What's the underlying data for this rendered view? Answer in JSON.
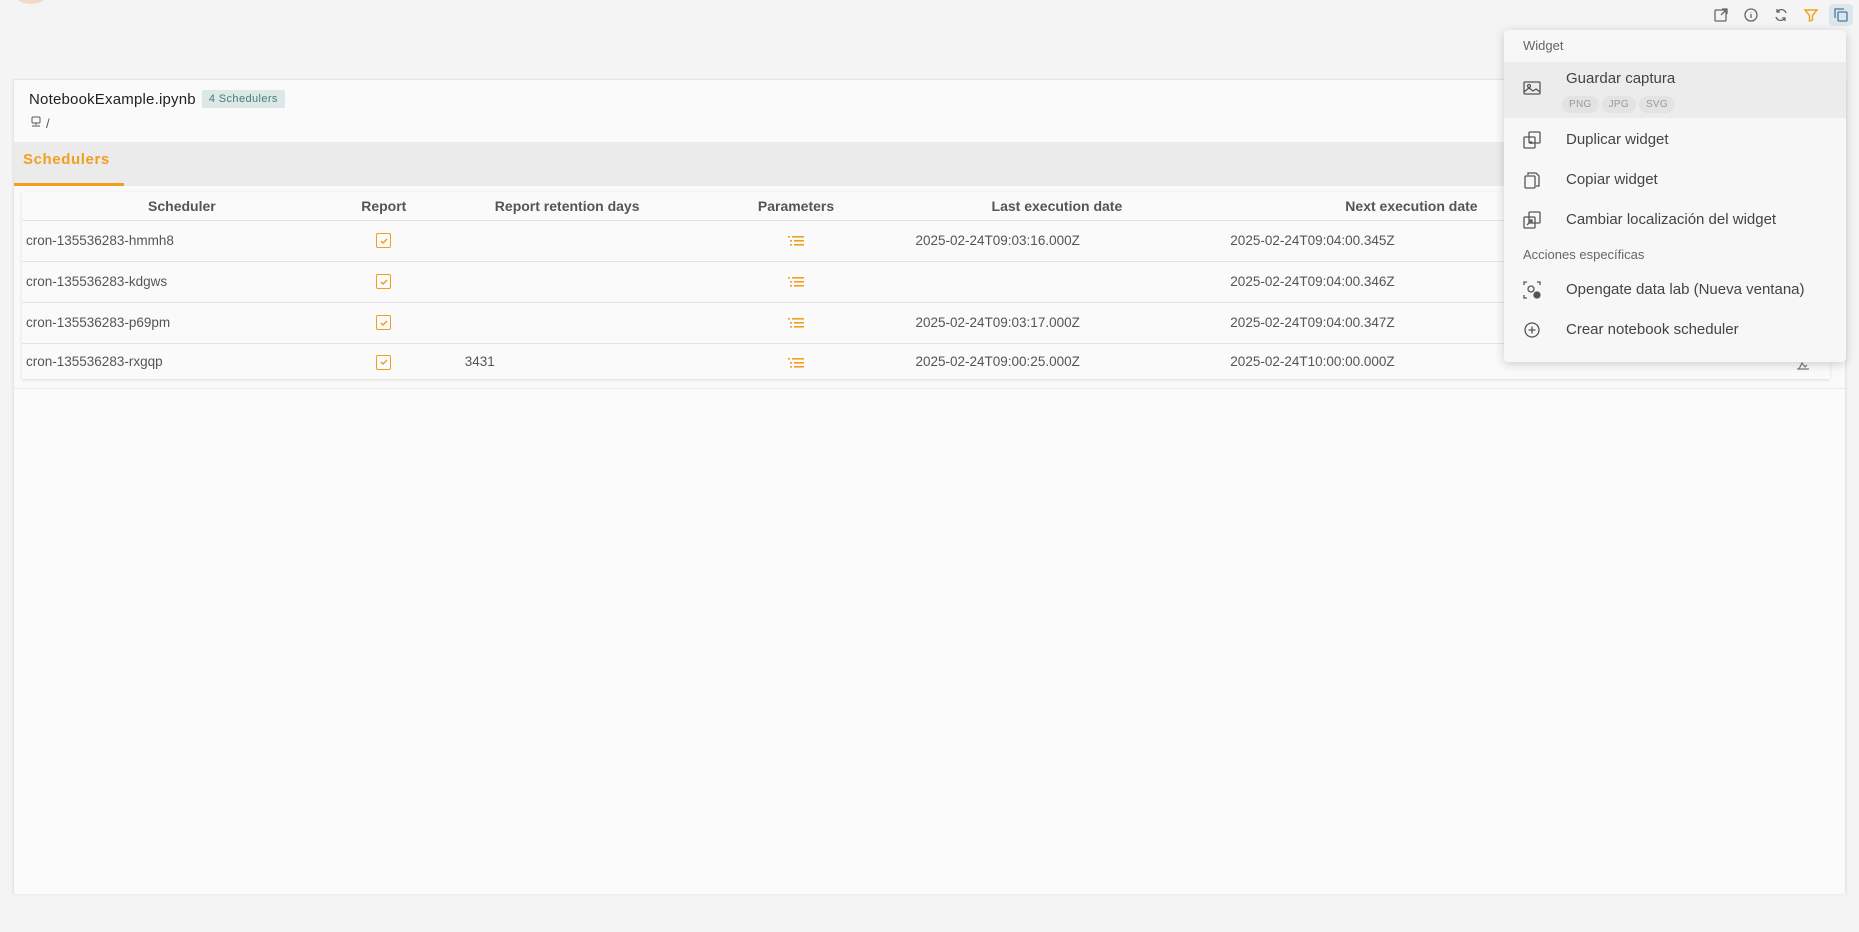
{
  "widget": {
    "title": "NotebookExample.ipynb",
    "badge": "4 Schedulers",
    "path": "/",
    "tab": "Schedulers"
  },
  "table": {
    "headers": [
      "Scheduler",
      "Report",
      "Report retention days",
      "Parameters",
      "Last execution date",
      "Next execution date"
    ],
    "rows": [
      {
        "scheduler": "cron-135536283-hmmh8",
        "report": true,
        "retention": "",
        "last": "2025-02-24T09:03:16.000Z",
        "next": "2025-02-24T09:04:00.345Z"
      },
      {
        "scheduler": "cron-135536283-kdgws",
        "report": true,
        "retention": "",
        "last": "",
        "next": "2025-02-24T09:04:00.346Z"
      },
      {
        "scheduler": "cron-135536283-p69pm",
        "report": true,
        "retention": "",
        "last": "2025-02-24T09:03:17.000Z",
        "next": "2025-02-24T09:04:00.347Z"
      },
      {
        "scheduler": "cron-135536283-rxgqp",
        "report": true,
        "retention": "3431",
        "last": "2025-02-24T09:00:25.000Z",
        "next": "2025-02-24T10:00:00.000Z"
      }
    ]
  },
  "menu": {
    "section_widget": "Widget",
    "save_capture": "Guardar captura",
    "formats": [
      "PNG",
      "JPG",
      "SVG"
    ],
    "duplicate": "Duplicar widget",
    "copy": "Copiar widget",
    "change_location": "Cambiar localización del widget",
    "section_specific": "Acciones específicas",
    "open_lab": "Opengate data lab (Nueva ventana)",
    "create_scheduler": "Crear notebook scheduler"
  },
  "colors": {
    "accent": "#f29f1f",
    "badge_bg": "#dbe8e6"
  }
}
